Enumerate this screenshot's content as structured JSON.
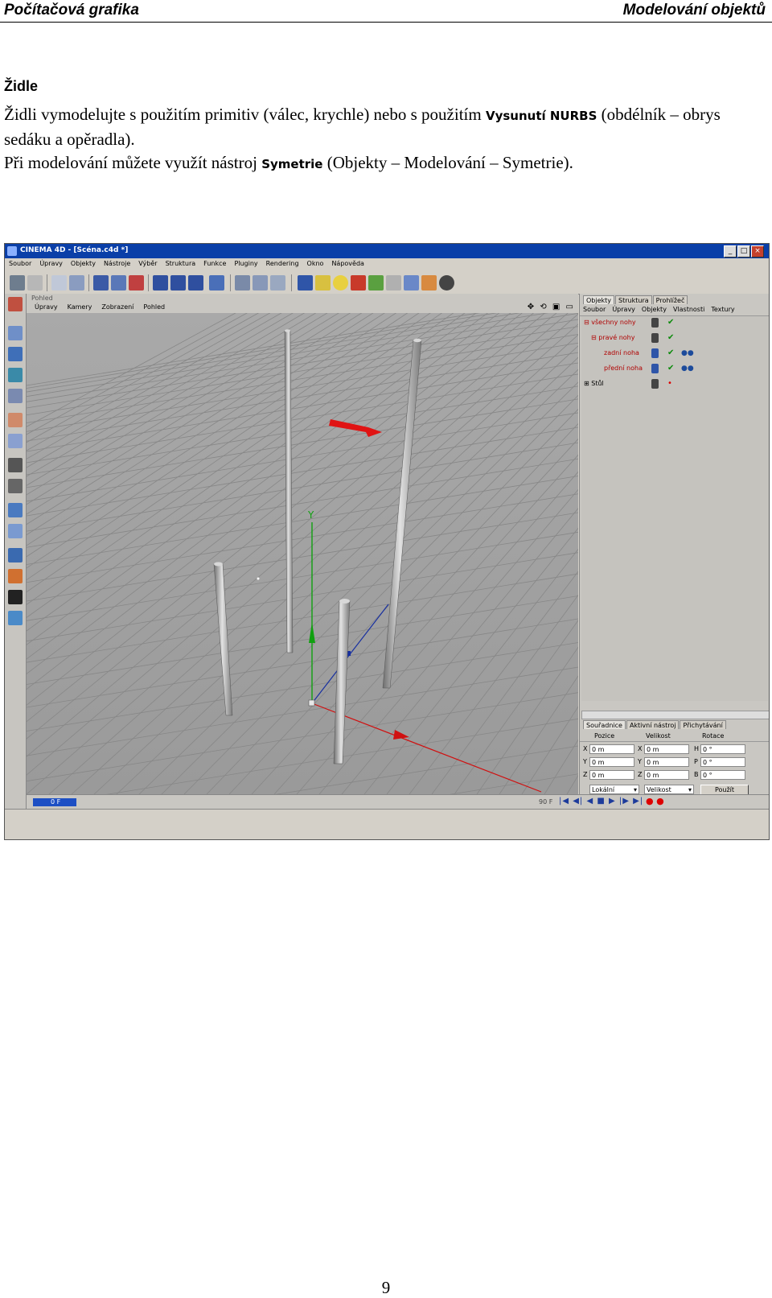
{
  "header": {
    "left": "Počítačová grafika",
    "right": "Modelování objektů"
  },
  "section": {
    "heading": "Židle",
    "p1_a": "Židli vymodelujte s použitím primitiv (válec, krychle) nebo s použitím ",
    "p1_term": "Vysunutí NURBS",
    "p1_b": " (obdélník – obrys sedáku a opěradla).",
    "p2_a": "Při modelování můžete využít nástroj ",
    "p2_term": "Symetrie",
    "p2_b": " (Objekty – Modelování – Symetrie)."
  },
  "app": {
    "title": "CINEMA 4D - [Scéna.c4d *]",
    "window_buttons": [
      "_",
      "□",
      "×"
    ],
    "menu": [
      "Soubor",
      "Úpravy",
      "Objekty",
      "Nástroje",
      "Výběr",
      "Struktura",
      "Funkce",
      "Pluginy",
      "Rendering",
      "Okno",
      "Nápověda"
    ],
    "viewport": {
      "title": "Pohled",
      "menu": [
        "Úpravy",
        "Kamery",
        "Zobrazení",
        "Pohled"
      ],
      "icons": "✥ ⟲ ▣ ▭",
      "axis_label": "Y"
    },
    "object_manager": {
      "tabs": [
        "Objekty",
        "Struktura",
        "Prohlížeč"
      ],
      "menu": [
        "Soubor",
        "Úpravy",
        "Objekty",
        "Vlastnosti",
        "Textury"
      ],
      "objects": [
        {
          "name": "⊟ všechny nohy"
        },
        {
          "name": "⊟ pravé nohy"
        },
        {
          "name": "zadní noha"
        },
        {
          "name": "přední noha"
        },
        {
          "name": "⊞ Stůl"
        }
      ]
    },
    "coordinates": {
      "tabs": [
        "Souřadnice",
        "Aktivní nástroj",
        "Přichytávání"
      ],
      "columns": [
        "Pozice",
        "Velikost",
        "Rotace"
      ],
      "rows": [
        {
          "label": "X",
          "pos": "0 m",
          "size_label": "X",
          "size": "0 m",
          "rot_label": "H",
          "rot": "0 °"
        },
        {
          "label": "Y",
          "pos": "0 m",
          "size_label": "Y",
          "size": "0 m",
          "rot_label": "P",
          "rot": "0 °"
        },
        {
          "label": "Z",
          "pos": "0 m",
          "size_label": "Z",
          "size": "0 m",
          "rot_label": "B",
          "rot": "0 °"
        }
      ],
      "mode": "Lokální",
      "scale_mode": "Velikost",
      "apply": "Použít"
    },
    "timeline": {
      "start": "0 F",
      "end": "90 F",
      "controls": "|◀ ◀| ◀ ■ ▶ |▶ ▶|",
      "record": "● ●"
    }
  },
  "page_number": "9",
  "colors": {
    "title_bar": "#0a3fa8",
    "viewport_bg": "#9d9d9d",
    "arrow": "#e01414",
    "object_names": "#b00000"
  }
}
